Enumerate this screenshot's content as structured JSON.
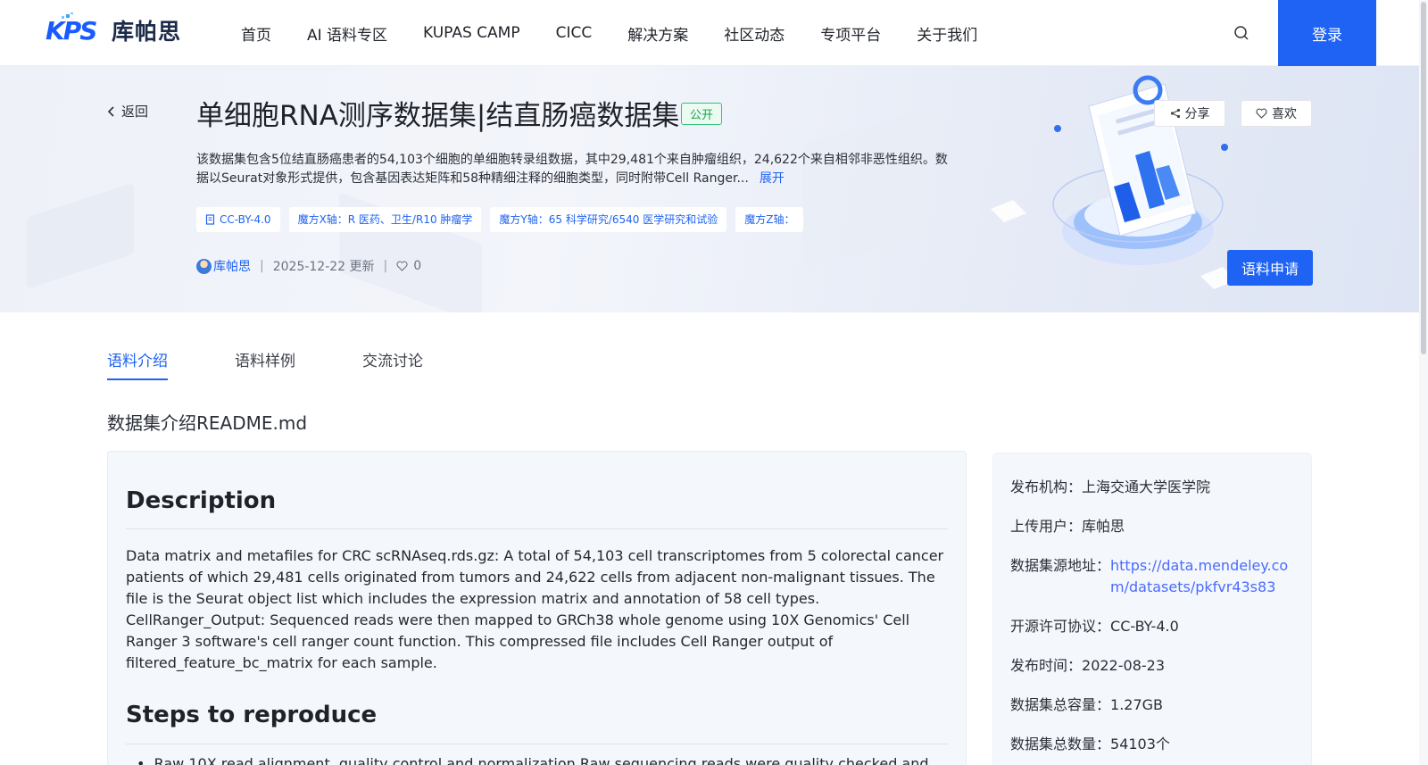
{
  "header": {
    "logo_mark": "KPS",
    "logo_text": "库帕思",
    "nav": [
      "首页",
      "AI 语料专区",
      "KUPAS CAMP",
      "CICC",
      "解决方案",
      "社区动态",
      "专项平台",
      "关于我们"
    ],
    "login_label": "登录"
  },
  "banner": {
    "back_label": "返回",
    "title": "单细胞RNA测序数据集|结直肠癌数据集",
    "badge": "公开",
    "description": "该数据集包含5位结直肠癌患者的54,103个细胞的单细胞转录组数据，其中29,481个来自肿瘤组织，24,622个来自相邻非恶性组织。数据以Seurat对象形式提供，包含基因表达矩阵和58种精细注释的细胞类型，同时附带Cell Ranger...",
    "expand_label": "展开",
    "tags": [
      "CC-BY-4.0",
      "魔方X轴：R 医药、卫生/R10 肿瘤学",
      "魔方Y轴：65 科学研究/6540 医学研究和试验",
      "魔方Z轴："
    ],
    "author": "库帕思",
    "updated": "2025-12-22 更新",
    "likes": "0",
    "share_label": "分享",
    "like_label": "喜欢",
    "apply_label": "语料申请"
  },
  "tabs": [
    {
      "label": "语料介绍",
      "active": true
    },
    {
      "label": "语料样例",
      "active": false
    },
    {
      "label": "交流讨论",
      "active": false
    }
  ],
  "readme": {
    "title": "数据集介绍README.md",
    "h_description": "Description",
    "body": "Data matrix and metafiles for CRC scRNAseq.rds.gz: A total of 54,103 cell transcriptomes from 5 colorectal cancer patients of which 29,481 cells originated from tumors and 24,622 cells from adjacent non-malignant tissues. The file is the Seurat object list which includes the expression matrix and annotation of 58 cell types. CellRanger_Output: Sequenced reads were then mapped to GRCh38 whole genome using 10X Genomics' Cell Ranger 3 software's cell ranger count function. This compressed file includes Cell Ranger output of filtered_feature_bc_matrix for each sample.",
    "h_steps": "Steps to reproduce",
    "step1": "Raw 10X read alignment, quality control and normalization Raw sequencing reads were quality checked and"
  },
  "info": {
    "org_k": "发布机构：",
    "org_v": "上海交通大学医学院",
    "uploader_k": "上传用户：",
    "uploader_v": "库帕思",
    "source_k": "数据集源地址：",
    "source_v": "https://data.mendeley.com/datasets/pkfvr43s83",
    "license_k": "开源许可协议：",
    "license_v": "CC-BY-4.0",
    "date_k": "发布时间：",
    "date_v": "2022-08-23",
    "size_k": "数据集总容量：",
    "size_v": "1.27GB",
    "count_k": "数据集总数量：",
    "count_v": "54103个"
  },
  "colors": {
    "accent": "#1e63f3",
    "badge_green": "#16a34a",
    "link": "#4b6bff"
  }
}
